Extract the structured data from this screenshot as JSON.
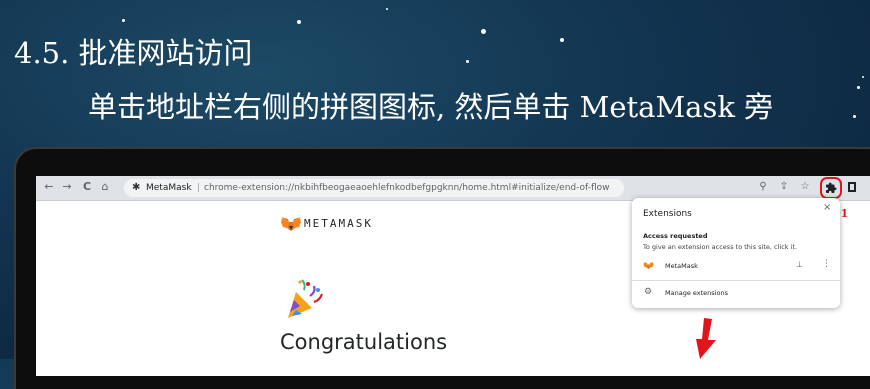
{
  "slide": {
    "heading": "4.5. 批准网站访问",
    "subheading": "单击地址栏右侧的拼图图标, 然后单击 MetaMask 旁"
  },
  "browser": {
    "nav": {
      "back_icon": "←",
      "forward_icon": "→",
      "reload_icon": "C",
      "home_icon": "⌂"
    },
    "omnibox": {
      "site_name": "MetaMask",
      "separator": "|",
      "url": "chrome-extension://nkbihfbeogaeaoehlefnkodbefgpgknn/home.html#initialize/end-of-flow"
    },
    "toolbar": {
      "zoom_icon": "⚲",
      "share_icon": "⇪",
      "star_icon": "☆",
      "extensions_icon": "puzzle-icon"
    },
    "step_label": "01"
  },
  "page": {
    "wordmark": "METAMASK",
    "congrats_title": "Congratulations"
  },
  "extensions_popup": {
    "title": "Extensions",
    "close": "×",
    "access_requested": "Access requested",
    "access_desc": "To give an extension access to this site, click it.",
    "extension_name": "MetaMask",
    "pin": "⊥",
    "more": "⋮",
    "manage_label": "Manage extensions",
    "gear": "⚙"
  },
  "colors": {
    "accent_red": "#e4141b",
    "background": "#123450",
    "metamask_orange": "#f6851b"
  }
}
